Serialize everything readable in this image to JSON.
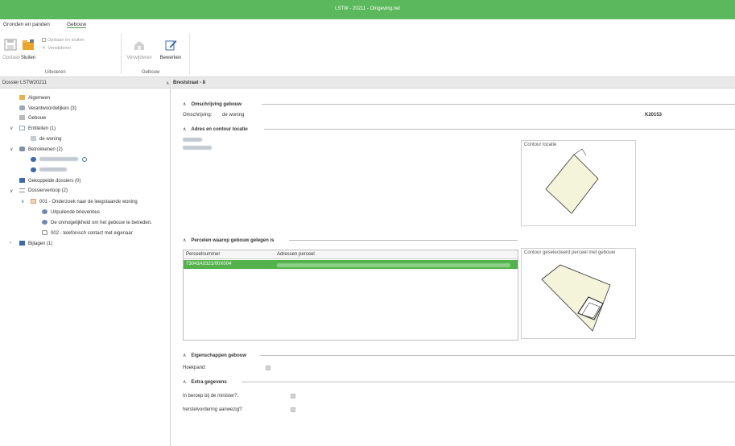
{
  "window": {
    "title": "LSTW - 20211 - Omgeving.net"
  },
  "tabs": [
    {
      "label": "Gronden en panden"
    },
    {
      "label": "Gebouw"
    }
  ],
  "ribbon": {
    "save_label": "Opslaan",
    "close_label": "Sluiten",
    "save_close_label": "Opslaan en sluiten",
    "delete_small_label": "Verwijderen",
    "delete_label": "Verwijderen",
    "edit_label": "Bewerken",
    "group_execute": "Uitvoeren",
    "group_building": "Gebouw"
  },
  "left": {
    "header": "Dossier LSTW20211",
    "items": {
      "general": "Algemeen",
      "responsible": "Verantwoordelijken (3)",
      "building": "Gebouw",
      "entities": "Entiteiten (1)",
      "dwelling": "de woning",
      "involved": "Betrokkenen (2)",
      "linked": "Gekoppelde dossiers (0)",
      "process": "Dossierverloop (2)",
      "case_001": "001 - Onderzoek naar de leegstaande woning",
      "mailbox": "Uitpuilende brievenbus",
      "unable": "De onmogelijkheid om het gebouw te betreden.",
      "case_002": "002 - telefonisch contact met eigenaar",
      "attachments": "Bijlagen (1)"
    }
  },
  "main": {
    "header": "Breslstraat - 8",
    "desc_section": "Omschrijving gebouw",
    "desc_label": "Omschrijving:",
    "desc_value": "de woning",
    "code": "K20153",
    "address_section": "Adres en contour locatie",
    "contour_title": "Contour locatie",
    "parcels_section": "Percelen waarop gebouw gelegen is",
    "grid": {
      "columns": [
        "Perceelnummer",
        "Adressen perceel"
      ],
      "rows": [
        {
          "parcel": "73043A0321/00X004"
        }
      ]
    },
    "contour_parcel_title": "Contour geselecteerd perceel met gebouw",
    "props_section": "Eigenschappen gebouw",
    "corner_label": "Hoekpand:",
    "extra_section": "Extra gegevens",
    "appeal_label": "In beroep bij de minister?:",
    "restore_label": "herstelvordering aanwezig?:"
  }
}
